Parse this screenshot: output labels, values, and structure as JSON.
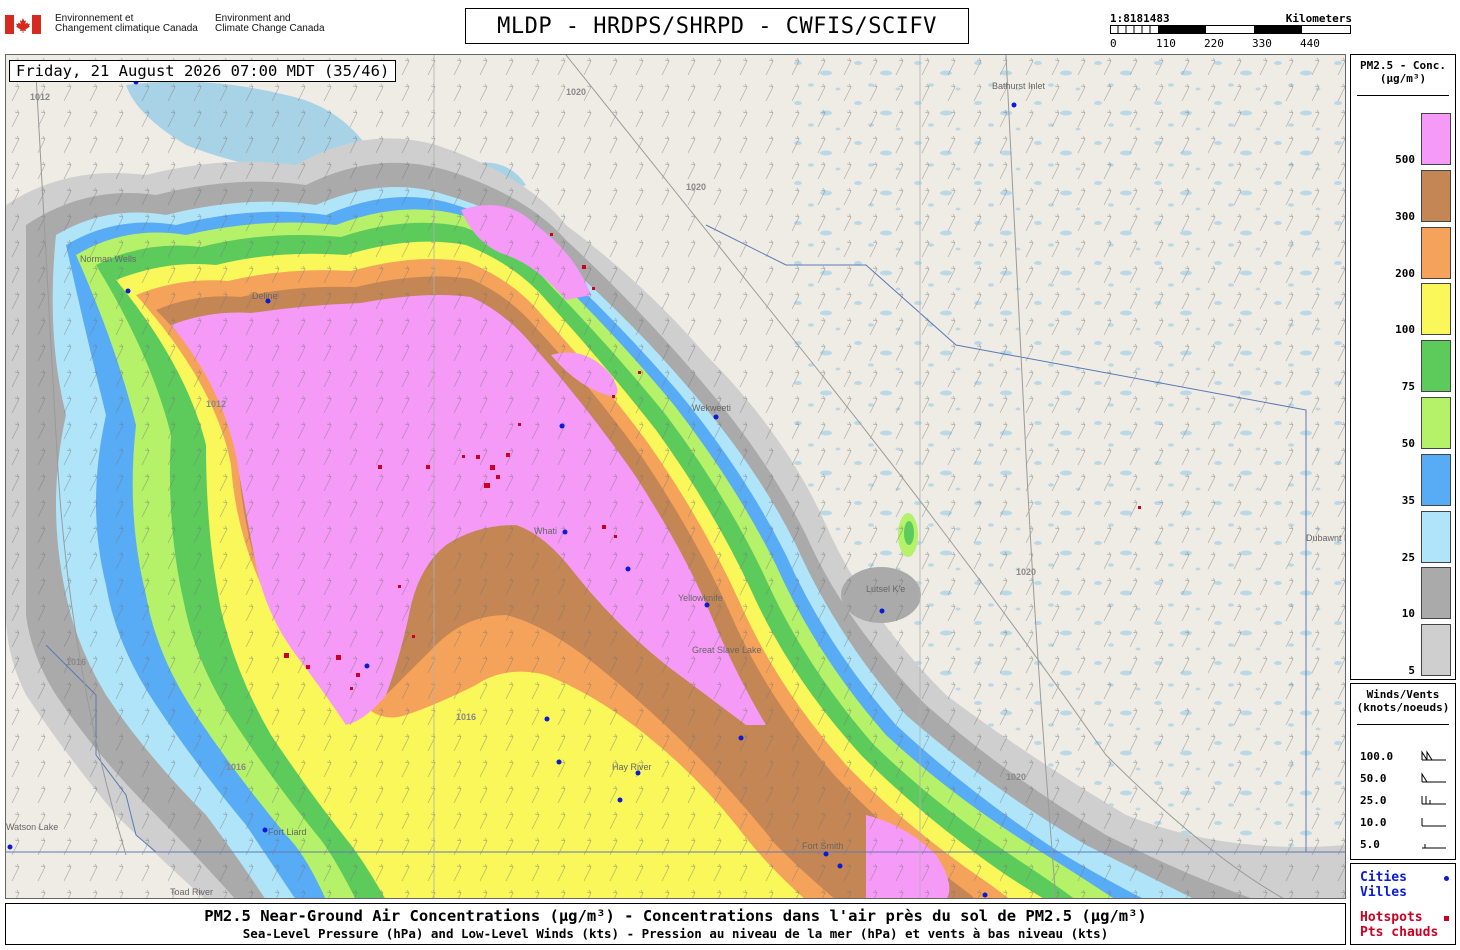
{
  "header": {
    "dept_fr_line1": "Environnement et",
    "dept_fr_line2": "Changement climatique Canada",
    "dept_en_line1": "Environment and",
    "dept_en_line2": "Climate Change Canada",
    "title": "MLDP - HRDPS/SHRPD - CWFIS/SCIFV"
  },
  "scale": {
    "ratio": "1:8181483",
    "unit": "Kilometers",
    "ticks": [
      "0",
      "110",
      "220",
      "330",
      "440"
    ]
  },
  "map": {
    "date_label": "Friday, 21 August 2026 07:00 MDT (35/46)",
    "places": [
      "Bathurst Inlet",
      "Norman Wells",
      "Deline",
      "Wekweeti",
      "Whati",
      "Yellowknife",
      "Lutsel K'e",
      "Hay River",
      "Fort Smith",
      "Fort Liard",
      "Toad River",
      "Watson Lake",
      "Dubawnt Lake",
      "Great Slave Lake"
    ],
    "isobars": [
      "1012",
      "1016",
      "1020"
    ]
  },
  "legend_pm": {
    "title_line1": "PM2.5 - Conc.",
    "title_line2": "(μg/m³)",
    "levels": [
      {
        "value": "500",
        "color": "#f59af7"
      },
      {
        "value": "300",
        "color": "#c48654"
      },
      {
        "value": "200",
        "color": "#f5a35a"
      },
      {
        "value": "100",
        "color": "#f9f75a"
      },
      {
        "value": "75",
        "color": "#5ccb5c"
      },
      {
        "value": "50",
        "color": "#b5f169"
      },
      {
        "value": "35",
        "color": "#58abf5"
      },
      {
        "value": "25",
        "color": "#b0e5f9"
      },
      {
        "value": "10",
        "color": "#aaaaaa"
      },
      {
        "value": "5",
        "color": "#cfcfcf"
      }
    ]
  },
  "legend_wind": {
    "title_line1": "Winds/Vents",
    "title_line2": "(knots/noeuds)",
    "rows": [
      "100.0",
      "50.0",
      "25.0",
      "10.0",
      "5.0"
    ]
  },
  "legend_points": {
    "cities_en": "Cities",
    "cities_fr": "Villes",
    "hotspots_en": "Hotspots",
    "hotspots_fr": "Pts chauds",
    "city_color": "#0a1bd4",
    "hotspot_color": "#cc0022"
  },
  "caption": {
    "line1": "PM2.5 Near-Ground Air Concentrations (μg/m³) - Concentrations dans l'air près du sol de PM2.5 (μg/m³)",
    "line2": "Sea-Level Pressure (hPa) and Low-Level Winds (kts) - Pression au niveau de la mer (hPa) et vents à bas niveau (kts)"
  }
}
